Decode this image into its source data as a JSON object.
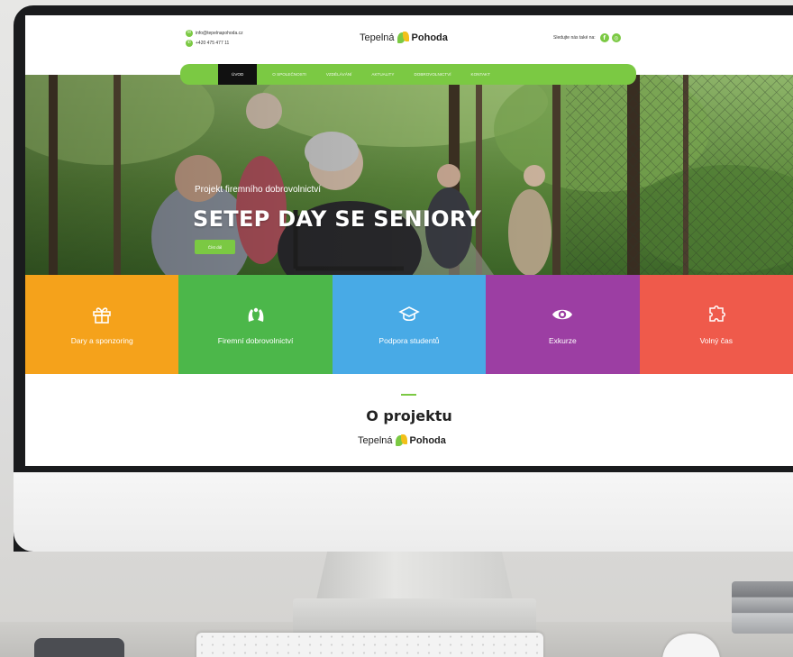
{
  "header": {
    "email": "info@tepelnapohoda.cz",
    "phone": "+420 475 477 11",
    "logo_light": "Tepelná",
    "logo_bold": "Pohoda",
    "social_text": "Sledujte nás také na:",
    "social_icons": [
      "facebook-icon",
      "instagram-icon"
    ]
  },
  "nav": {
    "items": [
      "Úvod",
      "O společnosti",
      "Vzdělávání",
      "Aktuality",
      "Dobrovolnictví",
      "Kontakt"
    ],
    "active": "Úvod"
  },
  "hero": {
    "subtitle": "Projekt firemního dobrovolnictví",
    "title": "SETEP DAY SE SENIORY",
    "button_label": "Číst dál"
  },
  "tiles": [
    {
      "label": "Dary a sponzoring",
      "icon": "gift-icon",
      "color": "#f5a21b"
    },
    {
      "label": "Firemní dobrovolnictví",
      "icon": "hands-icon",
      "color": "#4cb74a"
    },
    {
      "label": "Podpora studentů",
      "icon": "graduation-cap-icon",
      "color": "#48aae6"
    },
    {
      "label": "Exkurze",
      "icon": "eye-icon",
      "color": "#9c3ea3"
    },
    {
      "label": "Volný čas",
      "icon": "puzzle-icon",
      "color": "#ef5a4b"
    }
  ],
  "about": {
    "title": "O projektu",
    "logo_light": "Tepelná",
    "logo_bold": "Pohoda"
  },
  "colors": {
    "brand_green": "#7bc943",
    "brand_yellow": "#f2c018",
    "nav_active": "#111111"
  }
}
